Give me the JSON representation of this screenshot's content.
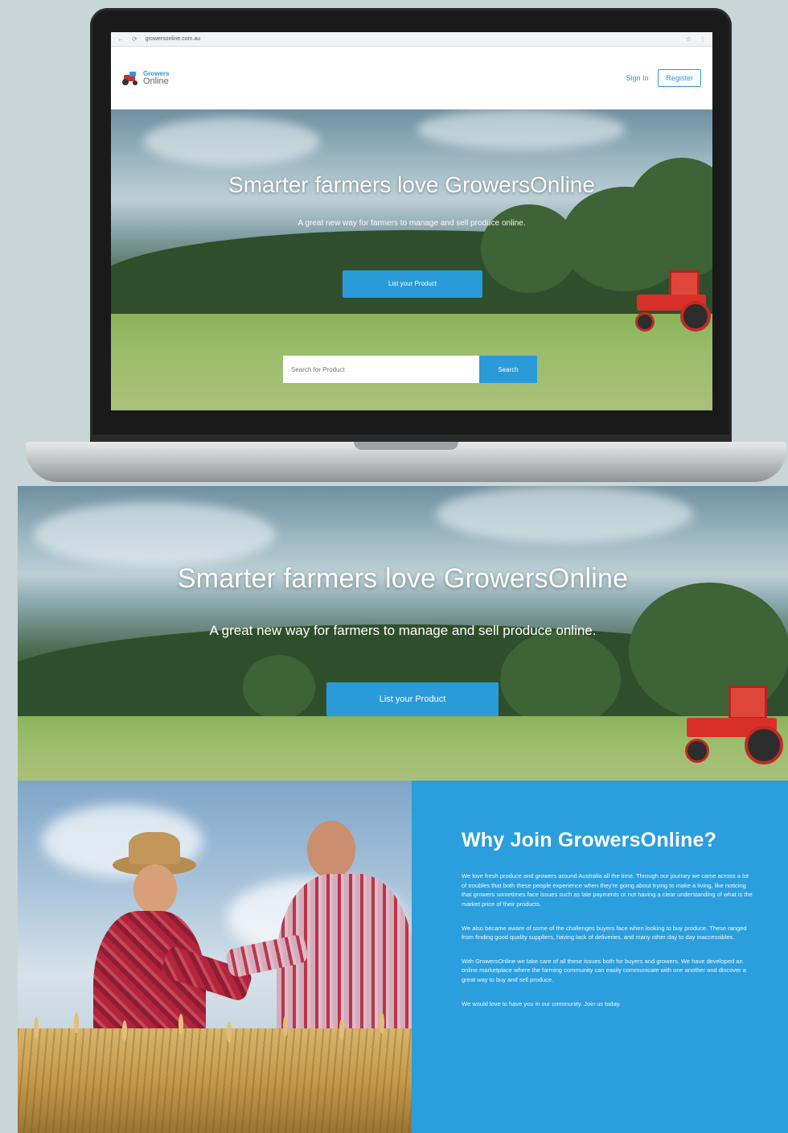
{
  "browser": {
    "url": "growersonline.com.au"
  },
  "site": {
    "logo_line1": "Growers",
    "logo_line2": "Online",
    "signin_label": "Sign In",
    "register_label": "Register"
  },
  "hero": {
    "title": "Smarter farmers love GrowersOnline",
    "subtitle": "A great new way for farmers to manage and sell produce online.",
    "cta_label": "List your Product",
    "search_placeholder": "Search for Product",
    "search_button": "Search"
  },
  "about": {
    "heading": "Why Join GrowersOnline?",
    "paragraphs": [
      "We love fresh produce and growers around Australia all the time. Through our journey we came across a lot of troubles that both these people experience when they're going about trying to make a living, like noticing that growers sometimes face issues such as late payments or not having a clear understanding of what is the market price of their products.",
      "We also became aware of some of the challenges buyers face when looking to buy produce. These ranged from finding good quality suppliers, having lack of deliveries, and many other day to day inaccessibles.",
      "With GrowersOnline we take care of all these issues both for buyers and growers. We have developed an online marketplace where the farming community can easily communicate with one another and discover a great way to buy and sell produce.",
      "We would love to have you in our community. Join us today."
    ]
  },
  "colors": {
    "brand_blue": "#2a9bd8",
    "about_panel_blue": "#2b9edd",
    "tractor_red": "#d9302a"
  }
}
